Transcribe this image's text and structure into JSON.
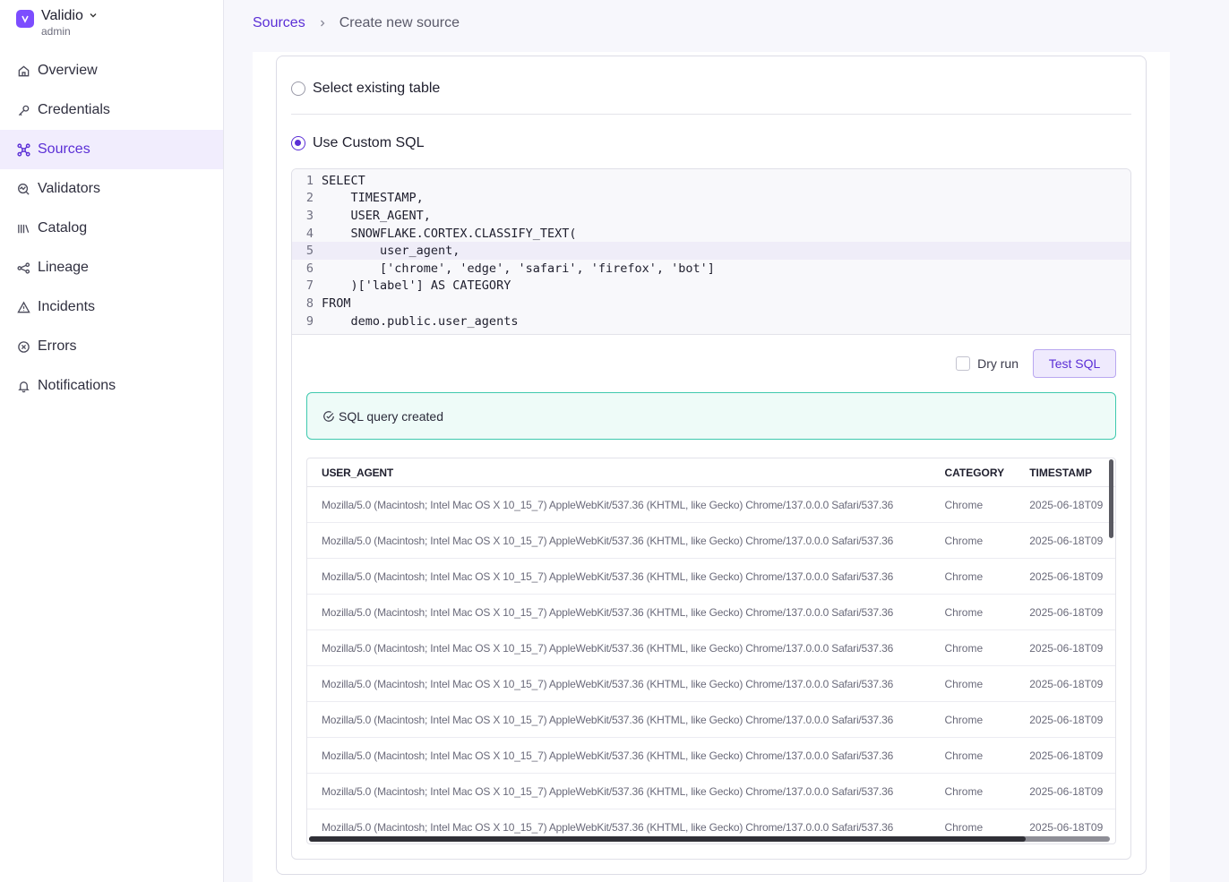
{
  "org": {
    "name": "Validio",
    "role": "admin"
  },
  "nav": [
    {
      "label": "Overview",
      "icon": "home-icon"
    },
    {
      "label": "Credentials",
      "icon": "key-icon"
    },
    {
      "label": "Sources",
      "icon": "sources-icon"
    },
    {
      "label": "Validators",
      "icon": "validator-icon"
    },
    {
      "label": "Catalog",
      "icon": "catalog-icon"
    },
    {
      "label": "Lineage",
      "icon": "lineage-icon"
    },
    {
      "label": "Incidents",
      "icon": "warning-icon"
    },
    {
      "label": "Errors",
      "icon": "error-icon"
    },
    {
      "label": "Notifications",
      "icon": "bell-icon"
    }
  ],
  "breadcrumb": {
    "root": "Sources",
    "current": "Create new source"
  },
  "options": {
    "existing": "Select existing table",
    "custom": "Use Custom SQL"
  },
  "sql_lines": [
    {
      "n": "1",
      "text": "SELECT"
    },
    {
      "n": "2",
      "text": "    TIMESTAMP,"
    },
    {
      "n": "3",
      "text": "    USER_AGENT,"
    },
    {
      "n": "4",
      "text": "    SNOWFLAKE.CORTEX.CLASSIFY_TEXT("
    },
    {
      "n": "5",
      "text": "        user_agent,"
    },
    {
      "n": "6",
      "text": "        ['chrome', 'edge', 'safari', 'firefox', 'bot']"
    },
    {
      "n": "7",
      "text": "    )['label'] AS CATEGORY"
    },
    {
      "n": "8",
      "text": "FROM"
    },
    {
      "n": "9",
      "text": "    demo.public.user_agents"
    }
  ],
  "actions": {
    "dry_run": "Dry run",
    "test_sql": "Test SQL"
  },
  "alert": {
    "text": "SQL query created"
  },
  "table": {
    "headers": [
      "USER_AGENT",
      "CATEGORY",
      "TIMESTAMP"
    ],
    "rows": [
      [
        "Mozilla/5.0 (Macintosh; Intel Mac OS X 10_15_7) AppleWebKit/537.36 (KHTML, like Gecko) Chrome/137.0.0.0 Safari/537.36",
        "Chrome",
        "2025-06-18T09"
      ],
      [
        "Mozilla/5.0 (Macintosh; Intel Mac OS X 10_15_7) AppleWebKit/537.36 (KHTML, like Gecko) Chrome/137.0.0.0 Safari/537.36",
        "Chrome",
        "2025-06-18T09"
      ],
      [
        "Mozilla/5.0 (Macintosh; Intel Mac OS X 10_15_7) AppleWebKit/537.36 (KHTML, like Gecko) Chrome/137.0.0.0 Safari/537.36",
        "Chrome",
        "2025-06-18T09"
      ],
      [
        "Mozilla/5.0 (Macintosh; Intel Mac OS X 10_15_7) AppleWebKit/537.36 (KHTML, like Gecko) Chrome/137.0.0.0 Safari/537.36",
        "Chrome",
        "2025-06-18T09"
      ],
      [
        "Mozilla/5.0 (Macintosh; Intel Mac OS X 10_15_7) AppleWebKit/537.36 (KHTML, like Gecko) Chrome/137.0.0.0 Safari/537.36",
        "Chrome",
        "2025-06-18T09"
      ],
      [
        "Mozilla/5.0 (Macintosh; Intel Mac OS X 10_15_7) AppleWebKit/537.36 (KHTML, like Gecko) Chrome/137.0.0.0 Safari/537.36",
        "Chrome",
        "2025-06-18T09"
      ],
      [
        "Mozilla/5.0 (Macintosh; Intel Mac OS X 10_15_7) AppleWebKit/537.36 (KHTML, like Gecko) Chrome/137.0.0.0 Safari/537.36",
        "Chrome",
        "2025-06-18T09"
      ],
      [
        "Mozilla/5.0 (Macintosh; Intel Mac OS X 10_15_7) AppleWebKit/537.36 (KHTML, like Gecko) Chrome/137.0.0.0 Safari/537.36",
        "Chrome",
        "2025-06-18T09"
      ],
      [
        "Mozilla/5.0 (Macintosh; Intel Mac OS X 10_15_7) AppleWebKit/537.36 (KHTML, like Gecko) Chrome/137.0.0.0 Safari/537.36",
        "Chrome",
        "2025-06-18T09"
      ],
      [
        "Mozilla/5.0 (Macintosh; Intel Mac OS X 10_15_7) AppleWebKit/537.36 (KHTML, like Gecko) Chrome/137.0.0.0 Safari/537.36",
        "Chrome",
        "2025-06-18T09"
      ]
    ]
  },
  "colors": {
    "accent": "#5b2fd6",
    "success_border": "#3fc9ae",
    "success_bg": "#eefbf8"
  }
}
